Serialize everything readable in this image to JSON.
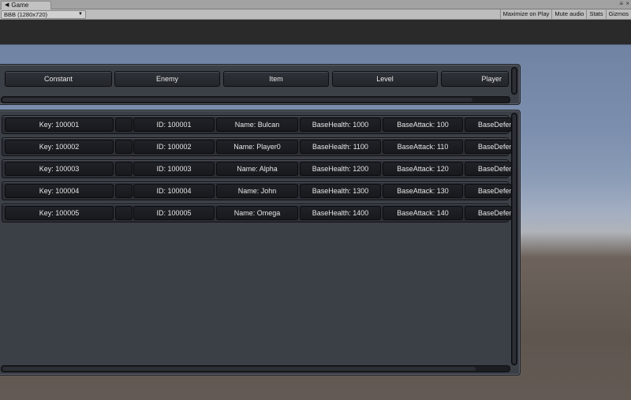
{
  "tab": {
    "title": "Game",
    "icon": "game-icon"
  },
  "toolbar": {
    "resolution": "BBB (1280x720)",
    "buttons": [
      "Maximize on Play",
      "Mute audio",
      "Stats",
      "Gizmos"
    ]
  },
  "categories": [
    "Constant",
    "Enemy",
    "Item",
    "Level",
    "Player"
  ],
  "rows": [
    {
      "key": "Key: 100001",
      "blank": "",
      "id": "ID: 100001",
      "name": "Name: Bulcan",
      "health": "BaseHealth: 1000",
      "attack": "BaseAttack: 100",
      "defense": "BaseDefen"
    },
    {
      "key": "Key: 100002",
      "blank": "",
      "id": "ID: 100002",
      "name": "Name: Player0",
      "health": "BaseHealth: 1100",
      "attack": "BaseAttack: 110",
      "defense": "BaseDefen"
    },
    {
      "key": "Key: 100003",
      "blank": "",
      "id": "ID: 100003",
      "name": "Name: Alpha",
      "health": "BaseHealth: 1200",
      "attack": "BaseAttack: 120",
      "defense": "BaseDefen"
    },
    {
      "key": "Key: 100004",
      "blank": "",
      "id": "ID: 100004",
      "name": "Name: John",
      "health": "BaseHealth: 1300",
      "attack": "BaseAttack: 130",
      "defense": "BaseDefen"
    },
    {
      "key": "Key: 100005",
      "blank": "",
      "id": "ID: 100005",
      "name": "Name: Omega",
      "health": "BaseHealth: 1400",
      "attack": "BaseAttack: 140",
      "defense": "BaseDefen"
    }
  ],
  "colors": {
    "panel": "#3b3f46",
    "cell": "#1f2227",
    "text": "#e6e6e6"
  }
}
